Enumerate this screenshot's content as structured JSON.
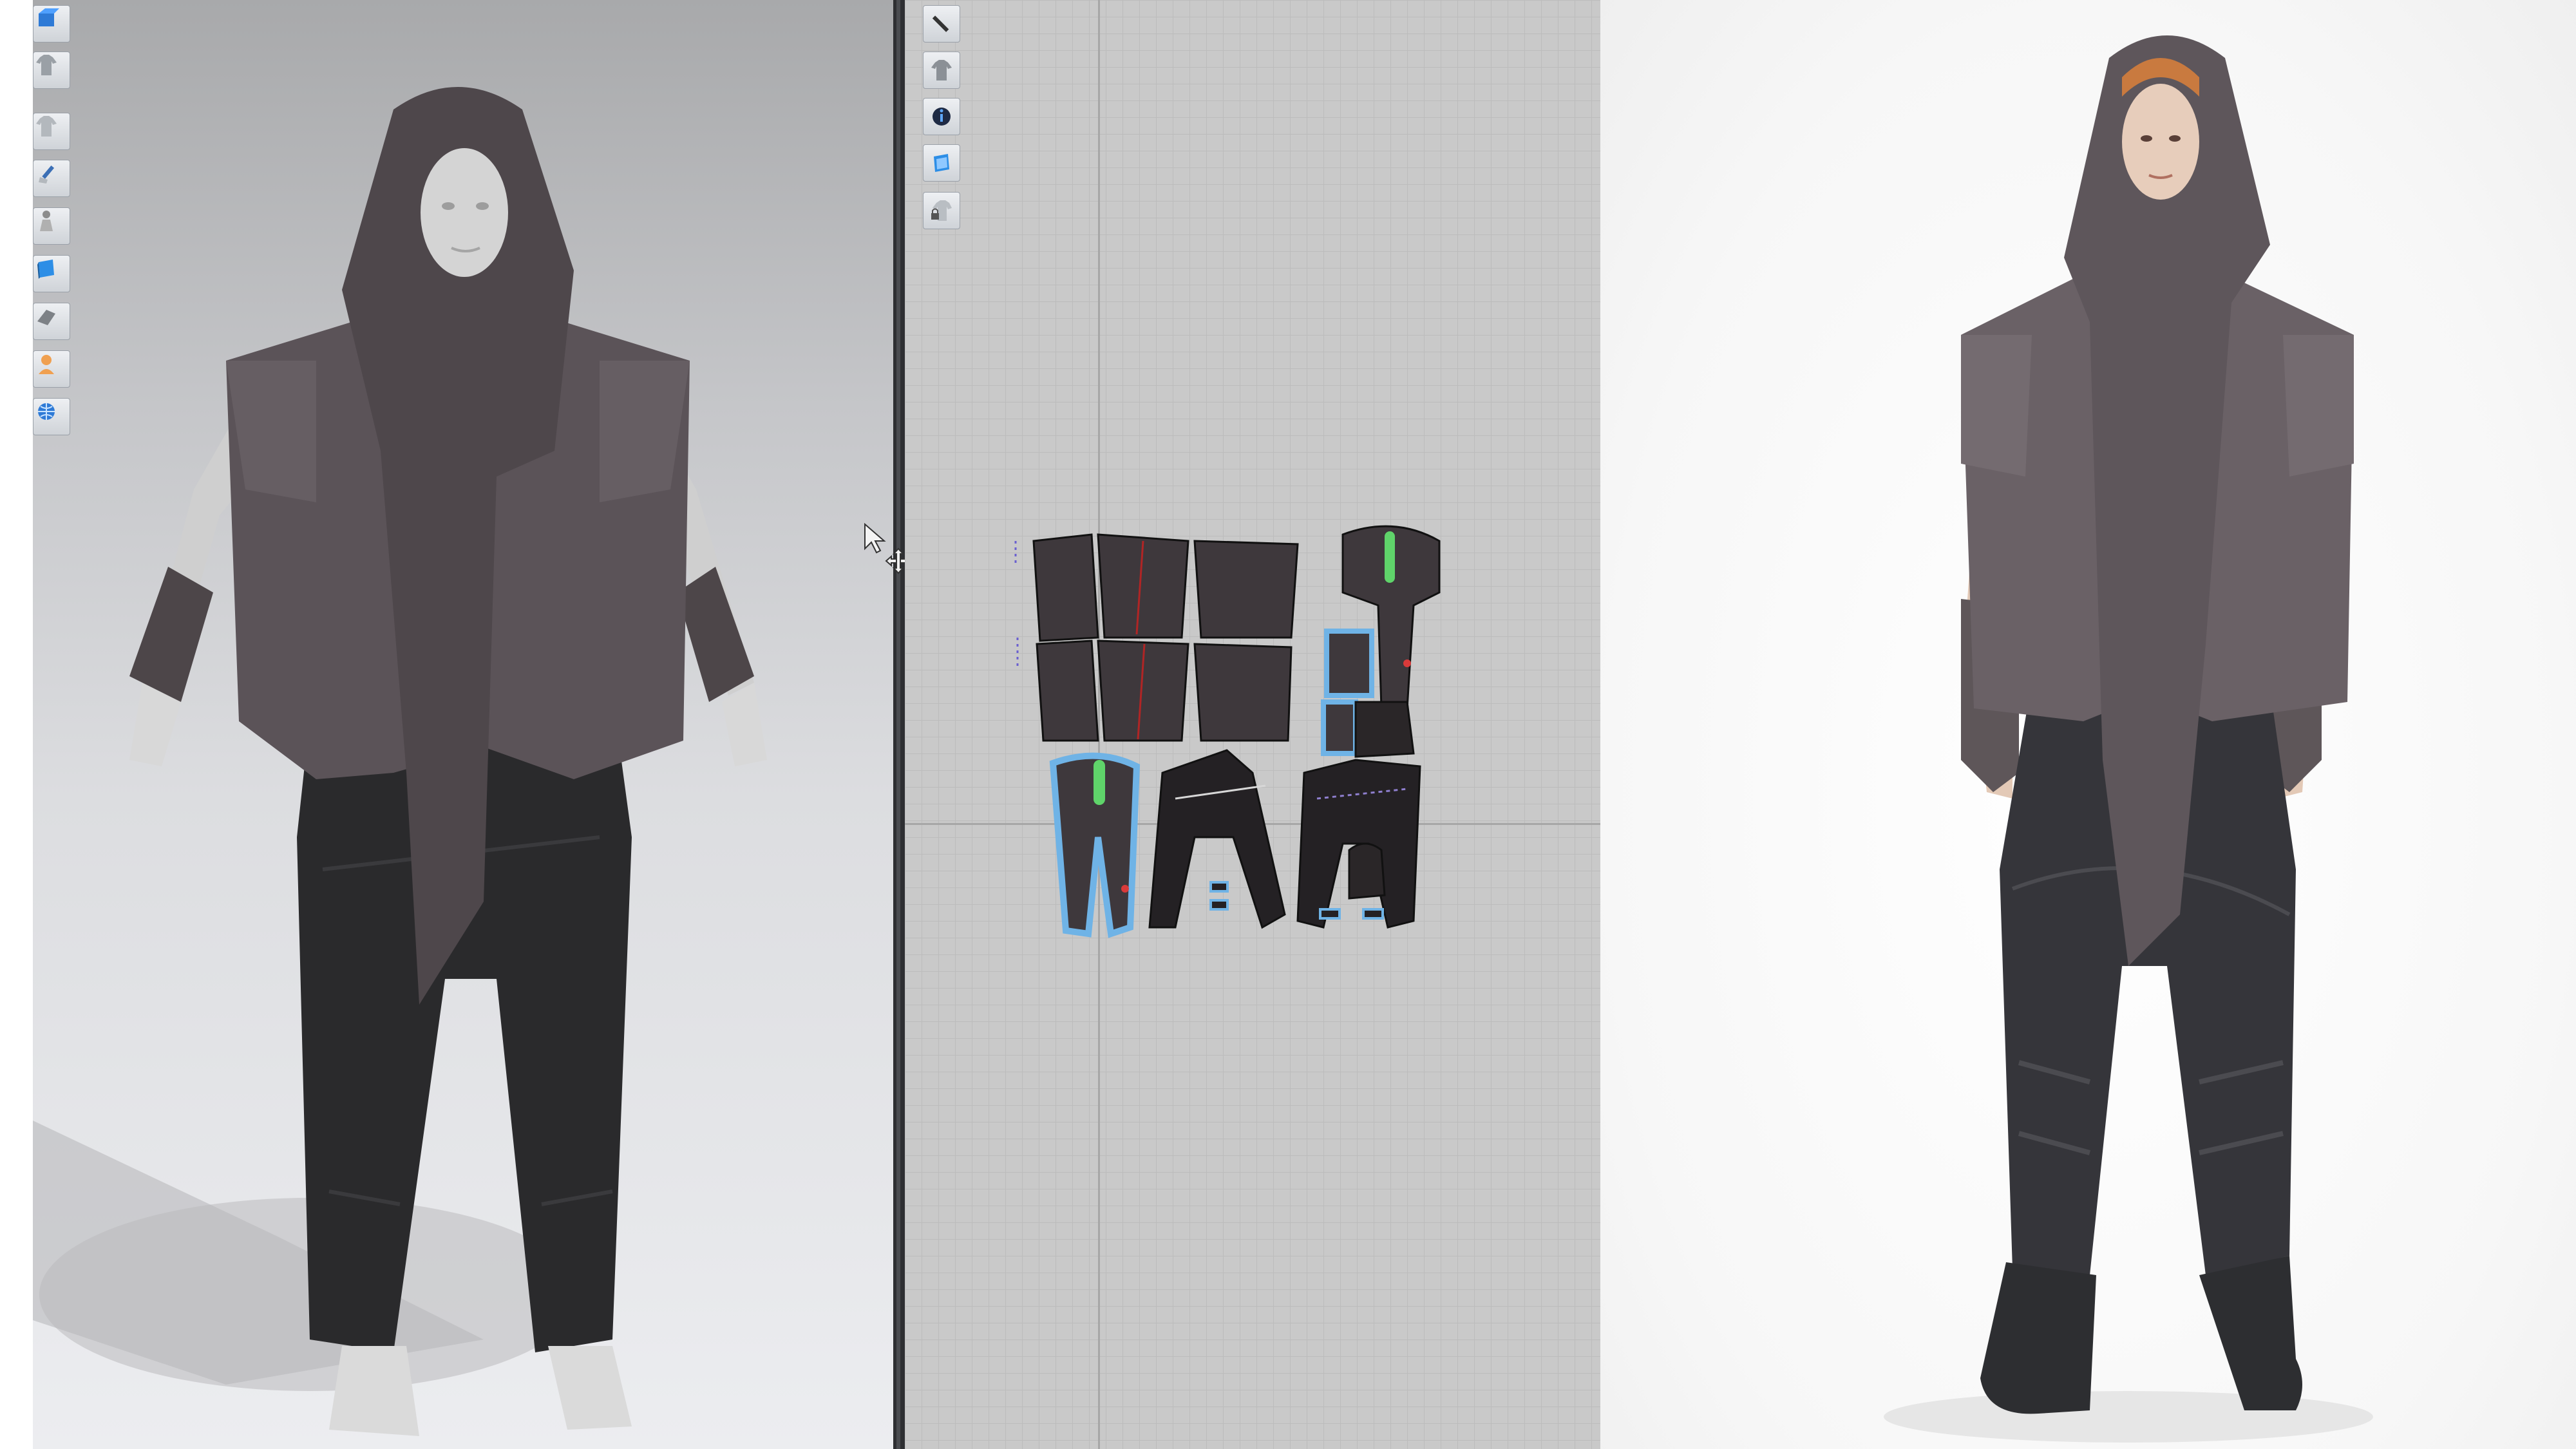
{
  "viewport_3d": {
    "toolbar_icons": [
      "display-avatar-icon",
      "display-garment-icon",
      "garment-shirt-icon",
      "simulation-brush-icon",
      "avatar-figure-icon",
      "texture-book-icon",
      "fabric-layer-icon",
      "avatar-skin-icon",
      "globe-environment-icon"
    ]
  },
  "viewport_2d": {
    "toolbar_icons": [
      "edit-pattern-icon",
      "show-garment-icon",
      "info-icon",
      "texture-view-icon",
      "lock-pattern-icon"
    ]
  },
  "colors": {
    "garment_gray": "#5b5358",
    "pants_black": "#2a2a2c",
    "avatar_skin": "#d6d6d6",
    "selection_blue": "#6fb3e6",
    "seam_green": "#5fd46a",
    "grid_background": "#c9c9c9"
  }
}
